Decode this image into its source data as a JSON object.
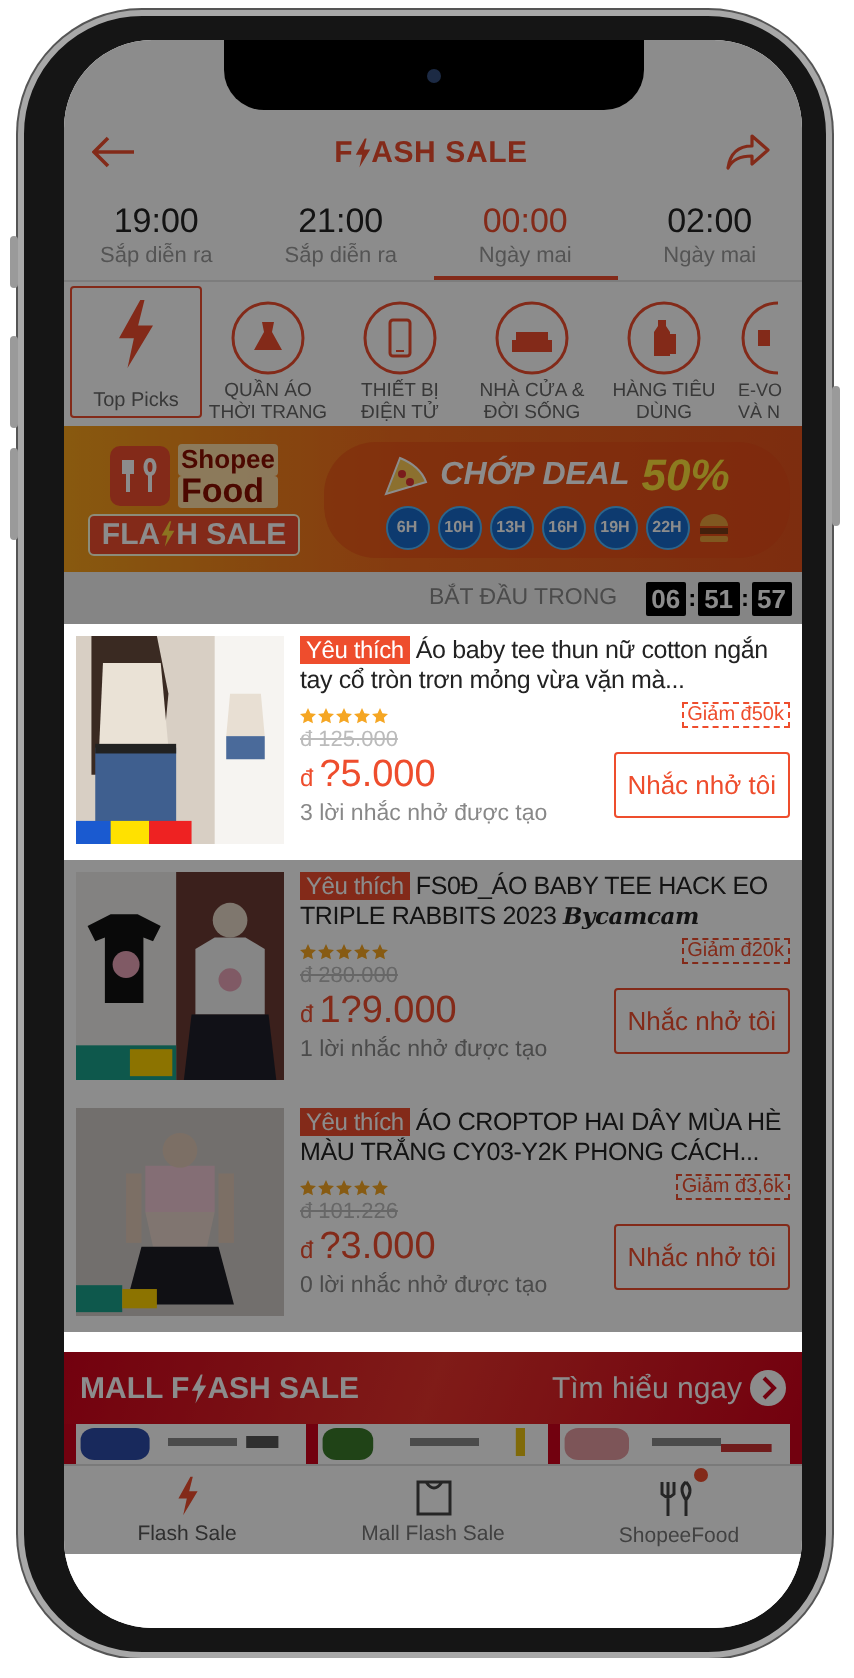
{
  "tutorial_overlay": {
    "on": true
  },
  "header": {
    "title_parts": [
      "F",
      "ASH SALE"
    ]
  },
  "time_slots": [
    {
      "time": "19:00",
      "status": "Sắp diễn ra",
      "selected": false
    },
    {
      "time": "21:00",
      "status": "Sắp diễn ra",
      "selected": false
    },
    {
      "time": "00:00",
      "status": "Ngày mai",
      "selected": true
    },
    {
      "time": "02:00",
      "status": "Ngày mai",
      "selected": false
    }
  ],
  "categories": [
    {
      "kind": "bolt",
      "label": "Top Picks",
      "selected": true
    },
    {
      "kind": "dress",
      "label": "QUẦN ÁO THỜI TRANG",
      "selected": false
    },
    {
      "kind": "phone",
      "label": "THIẾT BỊ ĐIỆN TỬ",
      "selected": false
    },
    {
      "kind": "sofa",
      "label": "NHÀ CỬA & ĐỜI SỐNG",
      "selected": false
    },
    {
      "kind": "bottle",
      "label": "HÀNG TIÊU DÙNG",
      "selected": false
    },
    {
      "kind": "partial",
      "label": "E-VO VÀ N",
      "selected": false
    }
  ],
  "food_banner": {
    "brand_top": "Shopee",
    "brand_bottom": "Food",
    "flash_parts": [
      "FLA",
      "H SALE"
    ],
    "deal": "CHỚP DEAL",
    "percent": "50%",
    "slots": [
      "6H",
      "10H",
      "13H",
      "16H",
      "19H",
      "22H"
    ]
  },
  "countdown": {
    "label": "BẮT ĐẦU TRONG",
    "parts": [
      {
        "kind": "digits",
        "text": "06"
      },
      {
        "kind": "sep",
        "text": ":"
      },
      {
        "kind": "digits",
        "text": "51"
      },
      {
        "kind": "sep",
        "text": ":"
      },
      {
        "kind": "digits",
        "text": "57"
      }
    ]
  },
  "products": [
    {
      "highlighted": true,
      "tag": "Yêu thích",
      "title": "Áo baby tee thun nữ cotton ngắn tay cổ tròn trơn mỏng vừa vặn mà...",
      "stars": 5,
      "discount": "Giảm đ50k",
      "old_price": "đ 125.000",
      "currency": "đ",
      "price": "?5.000",
      "reminders": "3 lời nhắc nhở được tạo",
      "button": "Nhắc nhở tôi"
    },
    {
      "highlighted": false,
      "tag": "Yêu thích",
      "title": "FS0Đ_ÁO BABY TEE HACK EO TRIPLE RABBITS 2023 **Bycamcam**",
      "stars": 5,
      "discount": "Giảm đ20k",
      "old_price": "đ 280.000",
      "currency": "đ",
      "price": "1?9.000",
      "reminders": "1 lời nhắc nhở được tạo",
      "button": "Nhắc nhở tôi"
    },
    {
      "highlighted": false,
      "tag": "Yêu thích",
      "title": "ÁO CROPTOP HAI DÂY MÙA HÈ MÀU TRẮNG CY03-Y2K PHONG CÁCH...",
      "stars": 5,
      "discount": "Giảm đ3,6k",
      "old_price": "đ 101.226",
      "currency": "đ",
      "price": "?3.000",
      "reminders": "0 lời nhắc nhở được tạo",
      "button": "Nhắc nhở tôi"
    }
  ],
  "mall_banner": {
    "title_parts": [
      "MALL F",
      "ASH SALE"
    ],
    "link": "Tìm hiểu ngay",
    "brands": [
      {
        "kind": "picture"
      },
      {
        "kind": "picture"
      },
      {
        "kind": "picture"
      }
    ]
  },
  "bottom_tabs": [
    {
      "kind": "bolt",
      "label": "Flash Sale",
      "selected": true,
      "badge": false
    },
    {
      "kind": "bag",
      "label": "Mall Flash Sale",
      "selected": false,
      "badge": false
    },
    {
      "kind": "food",
      "label": "ShopeeFood",
      "selected": false,
      "badge": true
    }
  ]
}
